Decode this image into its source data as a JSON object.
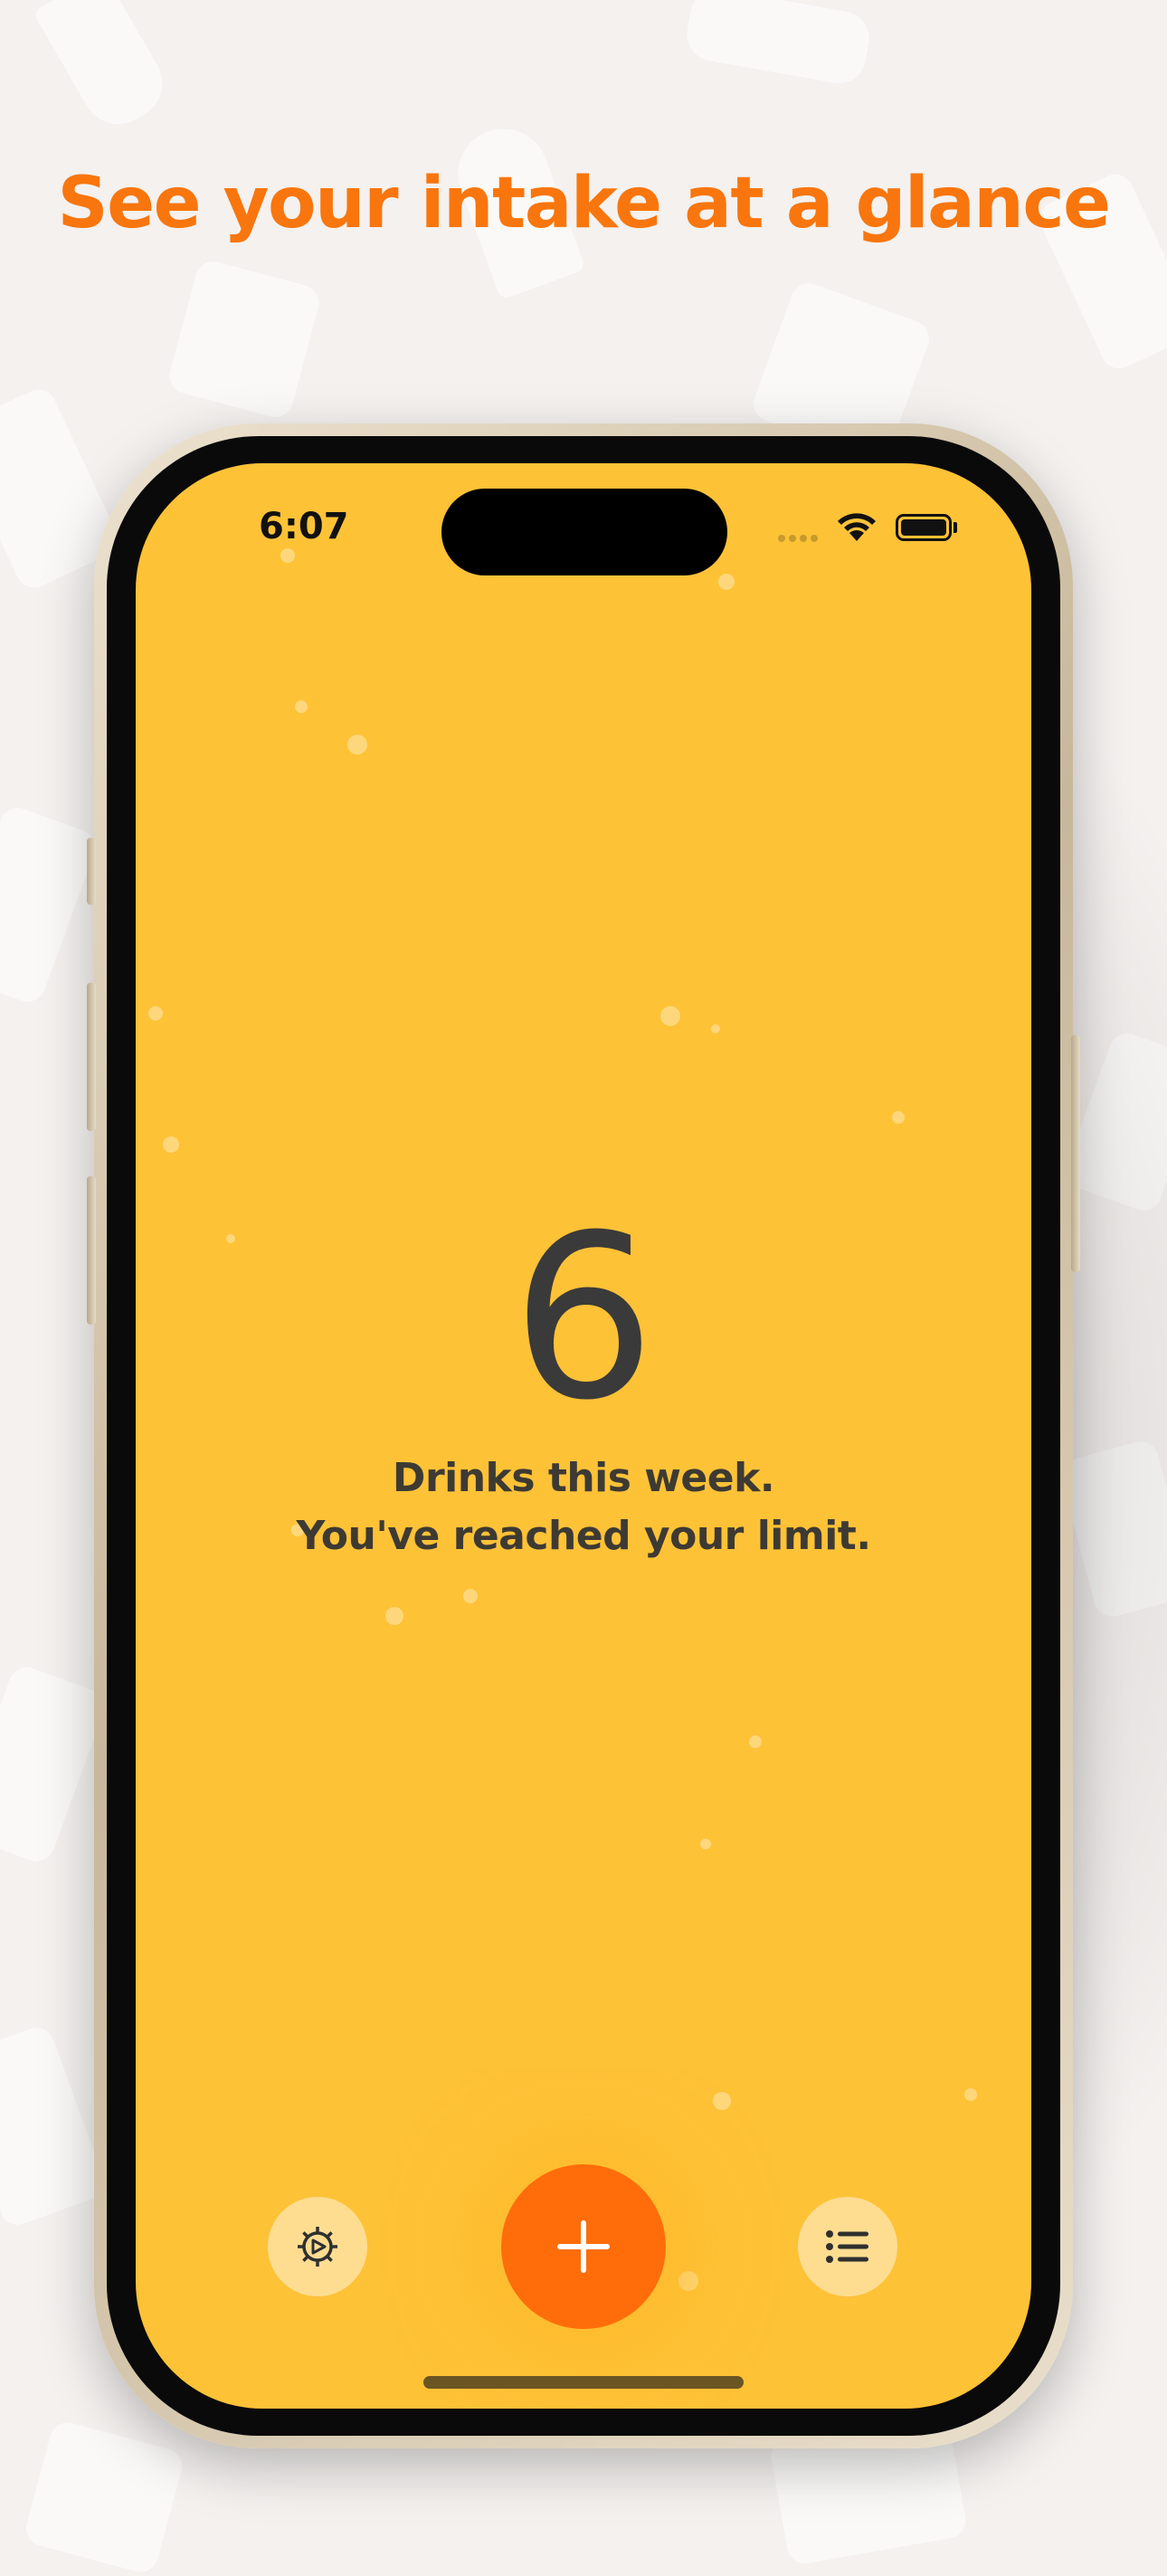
{
  "headline": "See your intake at a glance",
  "colors": {
    "accent": "#f8760d",
    "screen_background": "#fec237",
    "add_button": "#fe6d09",
    "text_dark": "#3a3a3a"
  },
  "status_bar": {
    "time": "6:07",
    "icons": [
      "cellular-signal-icon",
      "wifi-icon",
      "battery-icon"
    ]
  },
  "main": {
    "drink_count": "6",
    "caption_line1": "Drinks this week.",
    "caption_line2": "You've reached your limit."
  },
  "toolbar": {
    "settings_icon": "gear-icon",
    "add_icon": "plus-icon",
    "list_icon": "list-icon"
  }
}
